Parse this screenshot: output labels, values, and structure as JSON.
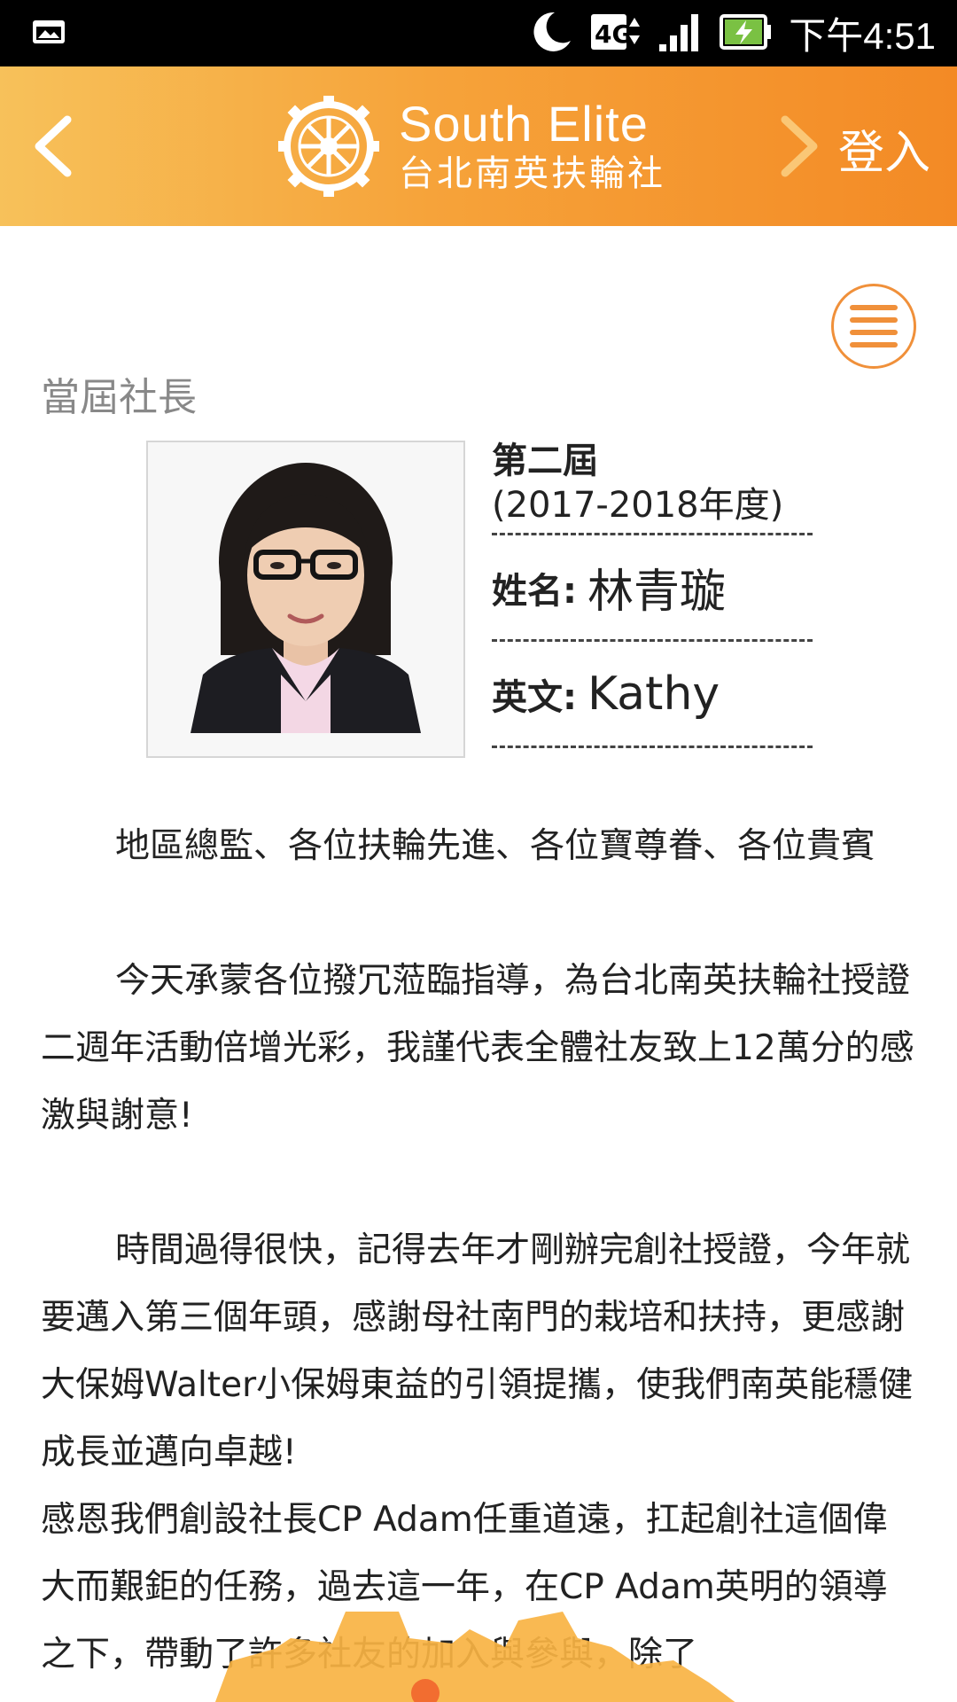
{
  "status_bar": {
    "network": "4G",
    "time": "下午4:51"
  },
  "header": {
    "logo_title": "South Elite",
    "logo_subtitle": "台北南英扶輪社",
    "login_label": "登入"
  },
  "colors": {
    "header_gradient_start": "#f7c15a",
    "header_gradient_end": "#f38a25",
    "accent": "#f0903a"
  },
  "section": {
    "title": "當屆社長"
  },
  "profile": {
    "term_label": "第二屆",
    "term_years": "(2017-2018年度)",
    "name_label": "姓名:",
    "name_value": "林青璇",
    "english_label": "英文:",
    "english_value": "Kathy"
  },
  "speech": {
    "p1": "地區總監、各位扶輪先進、各位寶尊眷、各位貴賓",
    "p2": "今天承蒙各位撥冗蒞臨指導，為台北南英扶輪社授證二週年活動倍增光彩，我謹代表全體社友致上12萬分的感激與謝意!",
    "p3": "時間過得很快，記得去年才剛辦完創社授證，今年就要邁入第三個年頭，感謝母社南門的栽培和扶持，更感謝大保姆Walter小保姆東益的引領提攜，使我們南英能穩健成長並邁向卓越!",
    "p4": "感恩我們創設社長CP Adam任重道遠，扛起創社這個偉大而艱鉅的任務，過去這一年，在CP Adam英明的領導之下，帶動了許多社友的加入與參與，除了"
  }
}
